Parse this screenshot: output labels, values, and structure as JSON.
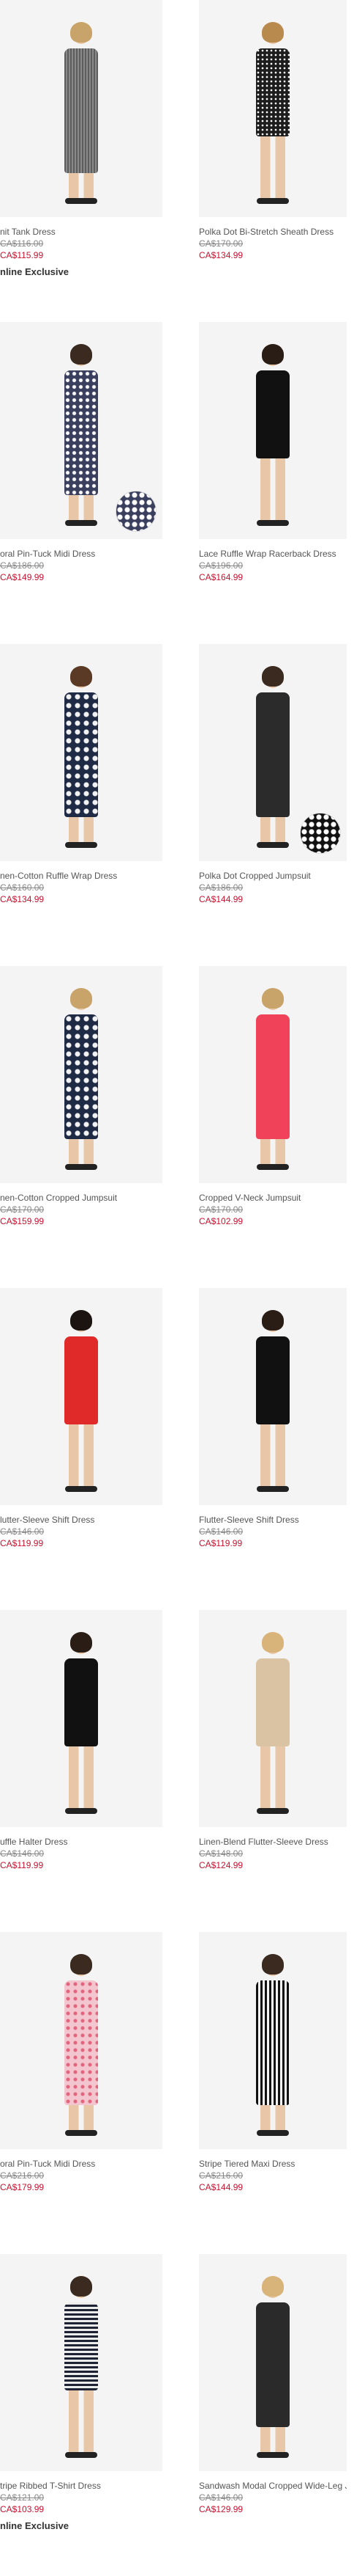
{
  "products": [
    {
      "name": "nit Tank Dress",
      "was": "CA$116.00",
      "now": "CA$115.99",
      "badge": "nline Exclusive",
      "dress": "#6b6b6b",
      "pattern": "stripe-grey",
      "hair": "#c9a46a"
    },
    {
      "name": "Polka Dot Bi-Stretch Sheath Dress",
      "was": "CA$170.00",
      "now": "CA$134.99",
      "badge": "",
      "dress": "#1d1d1d",
      "pattern": "dots",
      "hair": "#b98a4e"
    },
    {
      "name": "oral Pin-Tuck Midi Dress",
      "was": "CA$186.00",
      "now": "CA$149.99",
      "badge": "",
      "dress": "#3b3f5e",
      "pattern": "floral-dark",
      "hair": "#3a2a20"
    },
    {
      "name": "Lace Ruffle Wrap Racerback Dress",
      "was": "CA$196.00",
      "now": "CA$164.99",
      "badge": "",
      "dress": "#111111",
      "pattern": "solid",
      "hair": "#2a1d16"
    },
    {
      "name": "nen-Cotton Ruffle Wrap Dress",
      "was": "CA$160.00",
      "now": "CA$134.99",
      "badge": "",
      "dress": "#1f2a44",
      "pattern": "floral-navy",
      "hair": "#5a3a24"
    },
    {
      "name": "Polka Dot Cropped Jumpsuit",
      "was": "CA$186.00",
      "now": "CA$144.99",
      "badge": "",
      "dress": "#2b2b2b",
      "pattern": "solid",
      "hair": "#3a2a20"
    },
    {
      "name": "nen-Cotton Cropped Jumpsuit",
      "was": "CA$170.00",
      "now": "CA$159.99",
      "badge": "",
      "dress": "#1f2a44",
      "pattern": "floral-navy",
      "hair": "#c9a46a"
    },
    {
      "name": "Cropped V-Neck Jumpsuit",
      "was": "CA$170.00",
      "now": "CA$102.99",
      "badge": "",
      "dress": "#f0435a",
      "pattern": "solid",
      "hair": "#c9a46a"
    },
    {
      "name": "lutter-Sleeve Shift Dress",
      "was": "CA$146.00",
      "now": "CA$119.99",
      "badge": "",
      "dress": "#e02a2a",
      "pattern": "solid",
      "hair": "#1b1410"
    },
    {
      "name": "Flutter-Sleeve Shift Dress",
      "was": "CA$146.00",
      "now": "CA$119.99",
      "badge": "",
      "dress": "#111111",
      "pattern": "solid",
      "hair": "#2a1d16"
    },
    {
      "name": "uffle Halter Dress",
      "was": "CA$146.00",
      "now": "CA$119.99",
      "badge": "",
      "dress": "#111111",
      "pattern": "solid",
      "hair": "#2a1d16"
    },
    {
      "name": "Linen-Blend Flutter-Sleeve Dress",
      "was": "CA$148.00",
      "now": "CA$124.99",
      "badge": "",
      "dress": "#d9c3a3",
      "pattern": "solid",
      "hair": "#d8b47a"
    },
    {
      "name": "oral Pin-Tuck Midi Dress",
      "was": "CA$216.00",
      "now": "CA$179.99",
      "badge": "",
      "dress": "#f3c6cf",
      "pattern": "floral-pink",
      "hair": "#3a2a20"
    },
    {
      "name": "Stripe Tiered Maxi Dress",
      "was": "CA$216.00",
      "now": "CA$144.99",
      "badge": "",
      "dress": "#222222",
      "pattern": "stripe-bw",
      "hair": "#3a2a20"
    },
    {
      "name": "tripe Ribbed T-Shirt Dress",
      "was": "CA$121.00",
      "now": "CA$103.99",
      "badge": "nline Exclusive",
      "dress": "#2b2e3a",
      "pattern": "stripe-navy",
      "hair": "#3a2a20"
    },
    {
      "name": "Sandwash Modal Cropped Wide-Leg Jumpsuit",
      "was": "CA$146.00",
      "now": "CA$129.99",
      "badge": "",
      "dress": "#2a2a2a",
      "pattern": "solid",
      "hair": "#d8b47a"
    }
  ]
}
